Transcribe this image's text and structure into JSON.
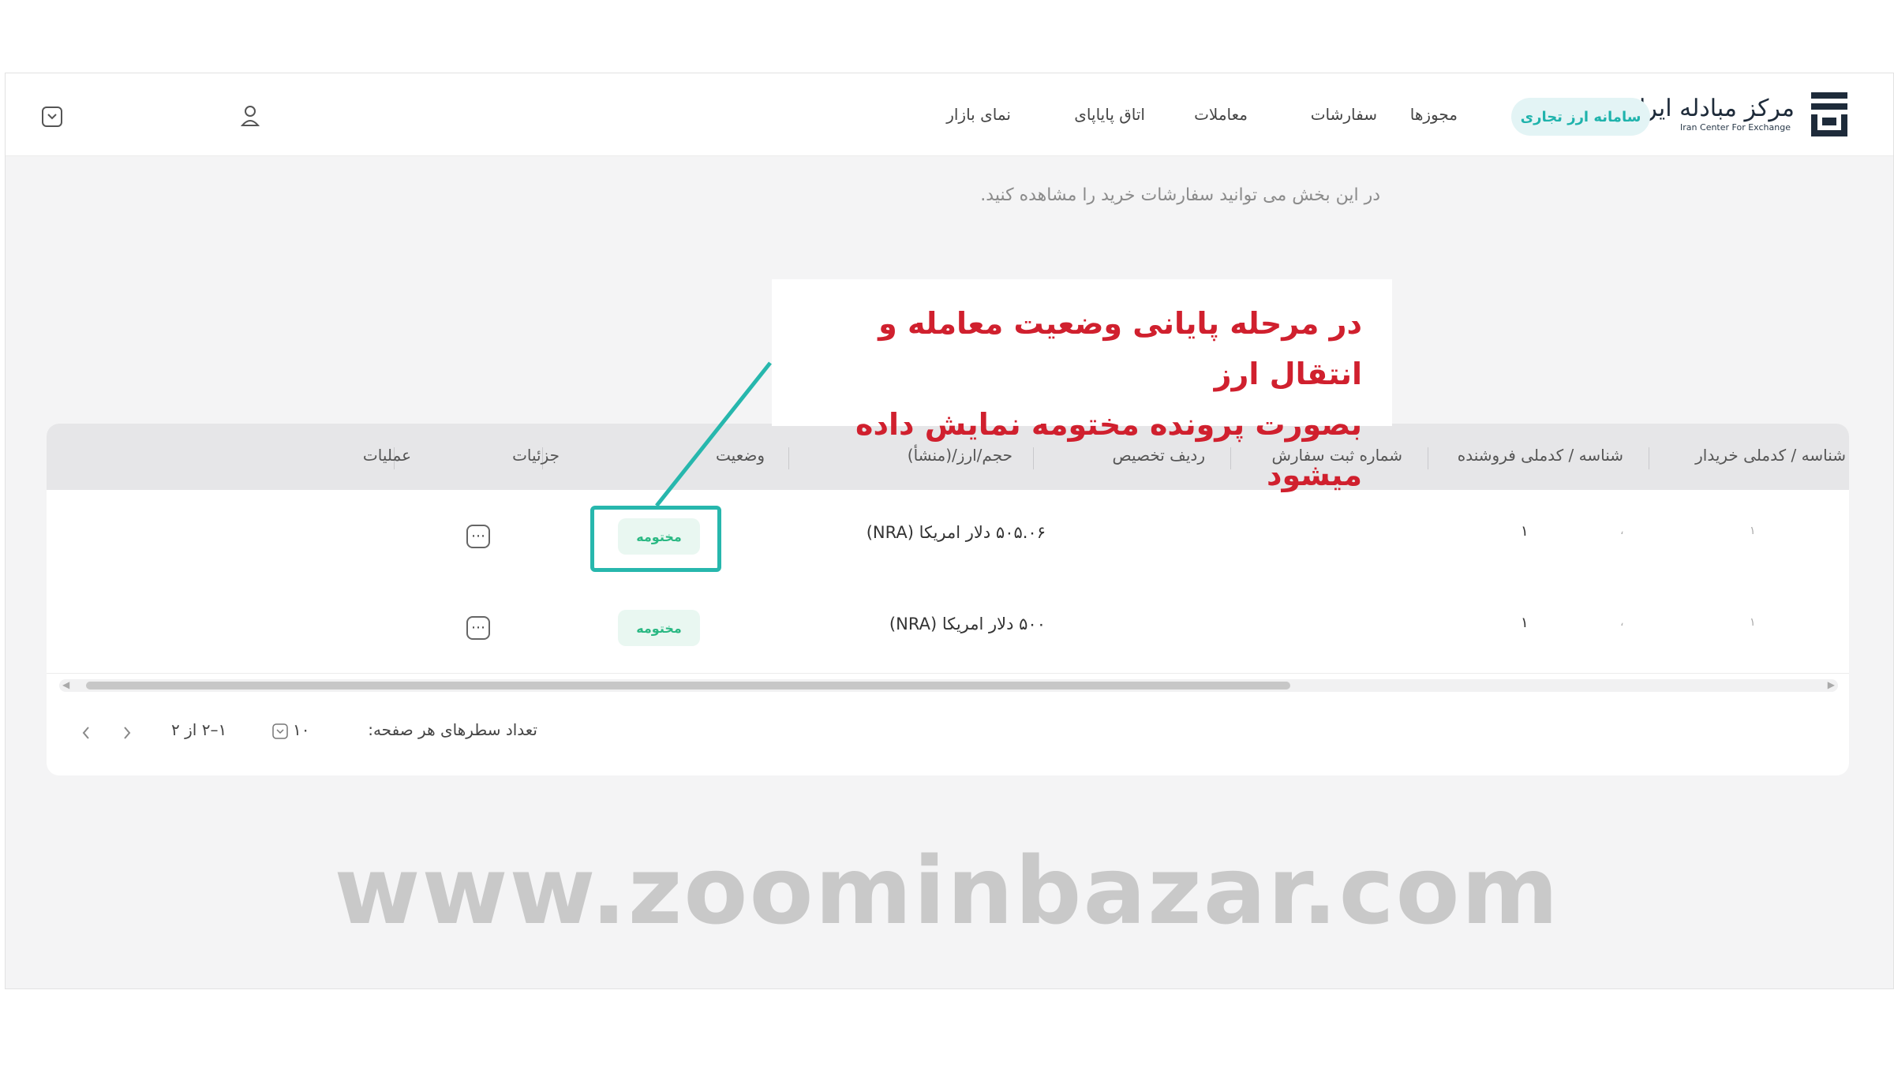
{
  "header": {
    "logo_text": "مرکز مبادله ایران",
    "logo_subtext": "Iran Center For Exchange",
    "active_pill": "سامانه ارز تجاری",
    "nav": [
      "مجوزها",
      "سفارشات",
      "معاملات",
      "اتاق پایاپای",
      "نمای بازار"
    ],
    "icons": [
      "user-icon",
      "chevron-down-icon"
    ]
  },
  "page": {
    "subtitle": "در این بخش می توانید سفارشات خرید را مشاهده کنید."
  },
  "table": {
    "columns": [
      "شناسه / کدملی خریدار",
      "شناسه / کدملی فروشنده",
      "شماره ثبت سفارش",
      "ردیف تخصیص",
      "حجم/ارز/(منشأ)",
      "وضعیت",
      "جزئیات",
      "عملیات"
    ],
    "rows": [
      {
        "buyer_mark": "۱",
        "seller_mark": "۱",
        "seller_sep": "،",
        "volume": "۵۰۵.۰۶ دلار امریکا (NRA)",
        "status": "مختومه",
        "details_icon": "more-icon"
      },
      {
        "buyer_mark": "۱",
        "seller_mark": "۱",
        "seller_sep": "،",
        "volume": "۵۰۰ دلار امریکا (NRA)",
        "status": "مختومه",
        "details_icon": "more-icon"
      }
    ]
  },
  "pagination": {
    "rows_per_page_label": "تعداد سطرهای هر صفحه:",
    "rows_per_page_value": "۱۰",
    "range": "۱–۲ از ۲",
    "prev_icon": "chevron-right-icon",
    "next_icon": "chevron-left-icon"
  },
  "callout": {
    "line1": "در مرحله پایانی وضعیت معامله و انتقال ارز",
    "line2": "بصورت پرونده مختومه نمایش داده میشود"
  },
  "watermark": "www.zoominbazar.com",
  "colors": {
    "accent": "#27b7ad",
    "badge_text": "#2ab883",
    "badge_bg": "#e9f7f1",
    "callout_text": "#d0202e",
    "header_bg": "#e6e6e8"
  }
}
